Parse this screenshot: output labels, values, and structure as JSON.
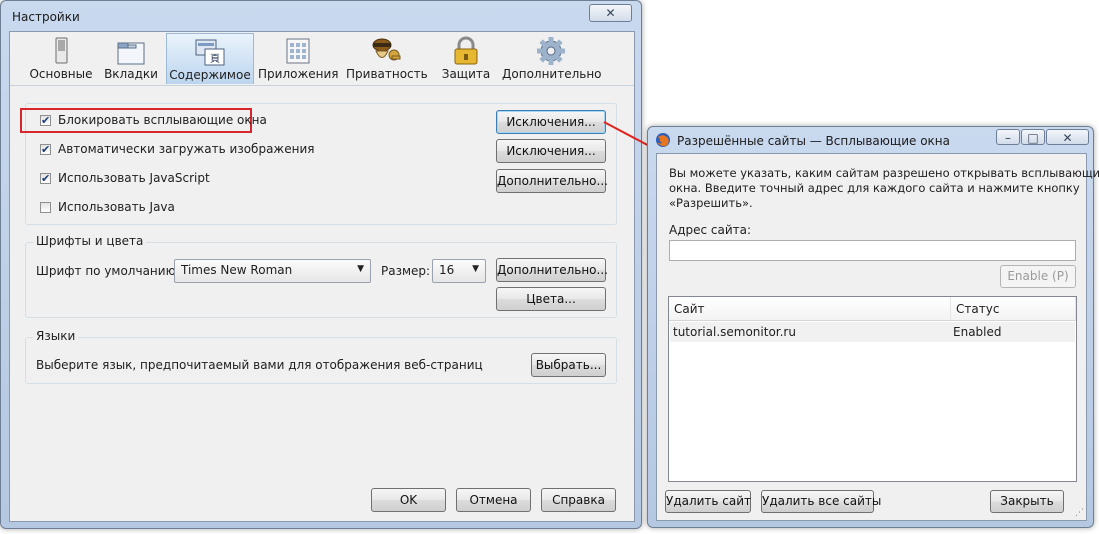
{
  "settings": {
    "title": "Настройки",
    "close_glyph": "✕",
    "tabs": [
      {
        "label": "Основные",
        "icon": "switch-icon"
      },
      {
        "label": "Вкладки",
        "icon": "tabs-icon"
      },
      {
        "label": "Содержимое",
        "icon": "content-icon"
      },
      {
        "label": "Приложения",
        "icon": "applications-icon"
      },
      {
        "label": "Приватность",
        "icon": "privacy-mask-icon"
      },
      {
        "label": "Защита",
        "icon": "padlock-icon"
      },
      {
        "label": "Дополнительно",
        "icon": "gear-icon"
      }
    ],
    "active_tab": "Содержимое",
    "content": {
      "checkboxes": [
        {
          "label": "Блокировать всплывающие окна",
          "checked": true
        },
        {
          "label": "Автоматически загружать изображения",
          "checked": true
        },
        {
          "label": "Использовать JavaScript",
          "checked": true
        },
        {
          "label": "Использовать Java",
          "checked": false
        }
      ],
      "exceptions_label": "Исключения...",
      "advanced_label": "Дополнительно...",
      "fonts_group": "Шрифты и цвета",
      "default_font_label": "Шрифт по умолчанию:",
      "default_font_value": "Times New Roman",
      "size_label": "Размер:",
      "size_value": "16",
      "fonts_advanced_label": "Дополнительно...",
      "colors_label": "Цвета...",
      "languages_group": "Языки",
      "languages_text": "Выберите язык, предпочитаемый вами для отображения веб-страниц",
      "choose_label": "Выбрать..."
    },
    "ok_label": "OK",
    "cancel_label": "Отмена",
    "help_label": "Справка"
  },
  "allowed": {
    "title": "Разрешённые сайты — Всплывающие окна",
    "description": [
      "Вы можете указать, каким сайтам разрешено открывать всплывающие",
      "окна. Введите точный адрес для каждого сайта и нажмите кнопку",
      "«Разрешить»."
    ],
    "address_label": "Адрес сайта:",
    "address_value": "",
    "enable_label": "Enable (P)",
    "columns": [
      "Сайт",
      "Статус"
    ],
    "rows": [
      {
        "site": "tutorial.semonitor.ru",
        "status": "Enabled"
      }
    ],
    "remove_site_label": "Удалить сайт",
    "remove_all_label": "Удалить все сайты",
    "close_label": "Закрыть"
  },
  "colors": {
    "highlight_red": "#d9262c",
    "arrow_red": "#e0241f",
    "active_tab_blue": "#bcd5ee"
  }
}
